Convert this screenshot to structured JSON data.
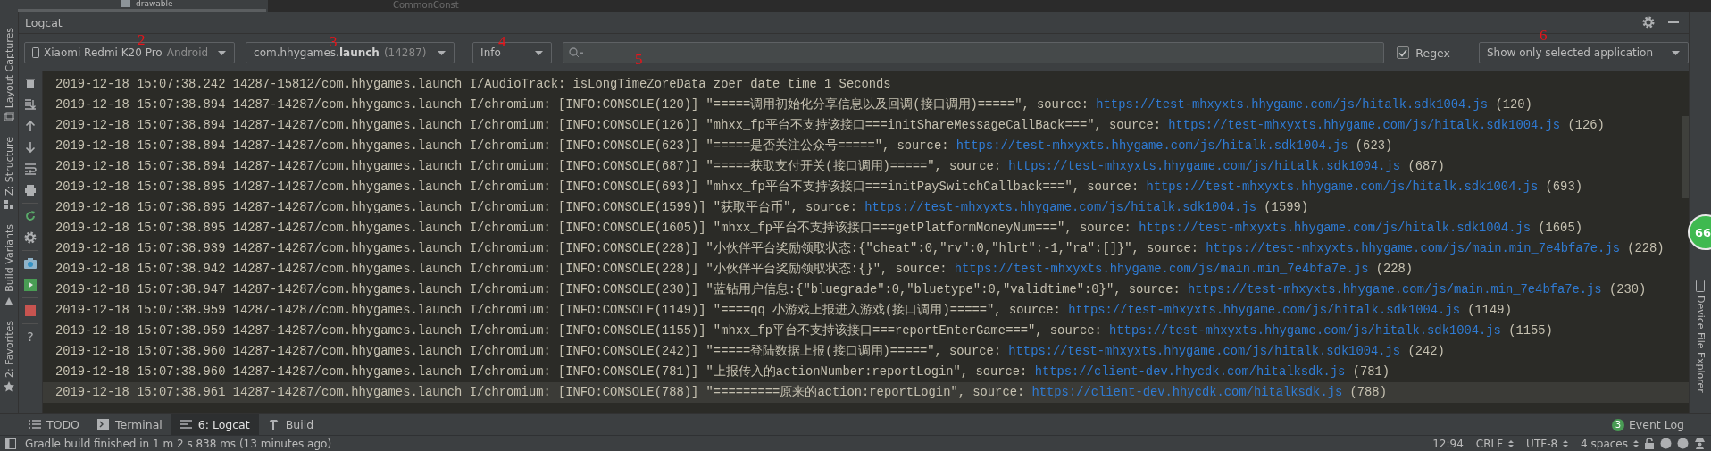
{
  "top_strip": {
    "tree_item": "drawable",
    "editor_tab": "CommonConst"
  },
  "left_stripe": [
    {
      "label": "Layout Captures",
      "kind": "layout"
    },
    {
      "label": "Z: Structure",
      "kind": "structure"
    },
    {
      "label": "Build Variants",
      "kind": "build"
    },
    {
      "label": "2: Favorites",
      "kind": "favorites"
    }
  ],
  "right_stripe": {
    "label": "Device File Explorer",
    "badge": "66"
  },
  "panel": {
    "title": "Logcat"
  },
  "toolbar": {
    "device": {
      "name": "Xiaomi Redmi K20 Pro",
      "os": "Android"
    },
    "process": {
      "package": "com.hhygames.",
      "app": "launch",
      "pid": "(14287)"
    },
    "level": "Info",
    "regex": {
      "label": "Regex",
      "checked": true
    },
    "filter": "Show only selected application"
  },
  "annotations": [
    "2",
    "3",
    "4",
    "5",
    "6"
  ],
  "side_tools": [
    {
      "kind": "trash"
    },
    {
      "kind": "scroll-end"
    },
    {
      "kind": "up"
    },
    {
      "kind": "down"
    },
    {
      "kind": "wrap"
    },
    {
      "kind": "print"
    },
    {
      "kind": "restart"
    },
    {
      "kind": "gear"
    },
    {
      "kind": "camera"
    },
    {
      "kind": "record"
    },
    {
      "kind": "stop"
    },
    {
      "kind": "help",
      "glyph": "?"
    }
  ],
  "log": [
    {
      "text": "2019-12-18 15:07:38.242 14287-15812/com.hhygames.launch I/AudioTrack: isLongTimeZoreData zoer date time 1 Seconds",
      "selected": false
    },
    {
      "text": "2019-12-18 15:07:38.894 14287-14287/com.hhygames.launch I/chromium: [INFO:CONSOLE(120)] \"=====调用初始化分享信息以及回调(接口调用)=====\", source: ",
      "source": "https://test-mhxyxts.hhygame.com/js/hitalk.sdk1004.js",
      "ref": " (120)",
      "selected": false
    },
    {
      "text": "2019-12-18 15:07:38.894 14287-14287/com.hhygames.launch I/chromium: [INFO:CONSOLE(126)] \"mhxx_fp平台不支持该接口===initShareMessageCallBack===\", source: ",
      "source": "https://test-mhxyxts.hhygame.com/js/hitalk.sdk1004.js",
      "ref": " (126)",
      "selected": false
    },
    {
      "text": "2019-12-18 15:07:38.894 14287-14287/com.hhygames.launch I/chromium: [INFO:CONSOLE(623)] \"=====是否关注公众号=====\", source: ",
      "source": "https://test-mhxyxts.hhygame.com/js/hitalk.sdk1004.js",
      "ref": " (623)",
      "selected": false
    },
    {
      "text": "2019-12-18 15:07:38.894 14287-14287/com.hhygames.launch I/chromium: [INFO:CONSOLE(687)] \"=====获取支付开关(接口调用)=====\", source: ",
      "source": "https://test-mhxyxts.hhygame.com/js/hitalk.sdk1004.js",
      "ref": " (687)",
      "selected": false
    },
    {
      "text": "2019-12-18 15:07:38.895 14287-14287/com.hhygames.launch I/chromium: [INFO:CONSOLE(693)] \"mhxx_fp平台不支持该接口===initPaySwitchCallback===\", source: ",
      "source": "https://test-mhxyxts.hhygame.com/js/hitalk.sdk1004.js",
      "ref": " (693)",
      "selected": false
    },
    {
      "text": "2019-12-18 15:07:38.895 14287-14287/com.hhygames.launch I/chromium: [INFO:CONSOLE(1599)] \"获取平台币\", source: ",
      "source": "https://test-mhxyxts.hhygame.com/js/hitalk.sdk1004.js",
      "ref": " (1599)",
      "selected": false
    },
    {
      "text": "2019-12-18 15:07:38.895 14287-14287/com.hhygames.launch I/chromium: [INFO:CONSOLE(1605)] \"mhxx_fp平台不支持该接口===getPlatformMoneyNum===\", source: ",
      "source": "https://test-mhxyxts.hhygame.com/js/hitalk.sdk1004.js",
      "ref": " (1605)",
      "selected": false
    },
    {
      "text": "2019-12-18 15:07:38.939 14287-14287/com.hhygames.launch I/chromium: [INFO:CONSOLE(228)] \"小伙伴平台奖励领取状态:{\"cheat\":0,\"rv\":0,\"hlrt\":-1,\"ra\":[]}\", source: ",
      "source": "https://test-mhxyxts.hhygame.com/js/main.min_7e4bfa7e.js",
      "ref": " (228)",
      "selected": false
    },
    {
      "text": "2019-12-18 15:07:38.942 14287-14287/com.hhygames.launch I/chromium: [INFO:CONSOLE(228)] \"小伙伴平台奖励领取状态:{}\", source: ",
      "source": "https://test-mhxyxts.hhygame.com/js/main.min_7e4bfa7e.js",
      "ref": " (228)",
      "selected": false
    },
    {
      "text": "2019-12-18 15:07:38.947 14287-14287/com.hhygames.launch I/chromium: [INFO:CONSOLE(230)] \"蓝钻用户信息:{\"bluegrade\":0,\"bluetype\":0,\"validtime\":0}\", source: ",
      "source": "https://test-mhxyxts.hhygame.com/js/main.min_7e4bfa7e.js",
      "ref": " (230)",
      "selected": false
    },
    {
      "text": "2019-12-18 15:07:38.959 14287-14287/com.hhygames.launch I/chromium: [INFO:CONSOLE(1149)] \"====qq 小游戏上报进入游戏(接口调用)=====\", source: ",
      "source": "https://test-mhxyxts.hhygame.com/js/hitalk.sdk1004.js",
      "ref": " (1149)",
      "selected": false
    },
    {
      "text": "2019-12-18 15:07:38.959 14287-14287/com.hhygames.launch I/chromium: [INFO:CONSOLE(1155)] \"mhxx_fp平台不支持该接口===reportEnterGame===\", source: ",
      "source": "https://test-mhxyxts.hhygame.com/js/hitalk.sdk1004.js",
      "ref": " (1155)",
      "selected": false
    },
    {
      "text": "2019-12-18 15:07:38.960 14287-14287/com.hhygames.launch I/chromium: [INFO:CONSOLE(242)] \"=====登陆数据上报(接口调用)=====\", source: ",
      "source": "https://test-mhxyxts.hhygame.com/js/hitalk.sdk1004.js",
      "ref": " (242)",
      "selected": false
    },
    {
      "text": "2019-12-18 15:07:38.960 14287-14287/com.hhygames.launch I/chromium: [INFO:CONSOLE(781)] \"上报传入的actionNumber:reportLogin\", source: ",
      "source": "https://client-dev.hhycdk.com/hitalksdk.js",
      "ref": " (781)",
      "selected": false
    },
    {
      "text": "2019-12-18 15:07:38.961 14287-14287/com.hhygames.launch I/chromium: [INFO:CONSOLE(788)] \"=========原来的action:reportLogin\", source: ",
      "source": "https://client-dev.hhycdk.com/hitalksdk.js",
      "ref": " (788)",
      "selected": true
    }
  ],
  "bottom_tabs": [
    {
      "label": "TODO",
      "kind": "list",
      "selected": false
    },
    {
      "label": "Terminal",
      "kind": "terminal",
      "selected": false
    },
    {
      "label": "6: Logcat",
      "kind": "logcat",
      "selected": true
    },
    {
      "label": "Build",
      "kind": "hammer",
      "selected": false
    }
  ],
  "event_log": {
    "label": "Event Log",
    "count": "3"
  },
  "status_bar": {
    "message": "Gradle build finished in 1 m 2 s 838 ms (13 minutes ago)",
    "items": [
      {
        "label": "12:94",
        "kind": "plain"
      },
      {
        "label": "CRLF",
        "kind": "select"
      },
      {
        "label": "UTF-8",
        "kind": "select"
      },
      {
        "label": "4 spaces",
        "kind": "select"
      }
    ]
  }
}
